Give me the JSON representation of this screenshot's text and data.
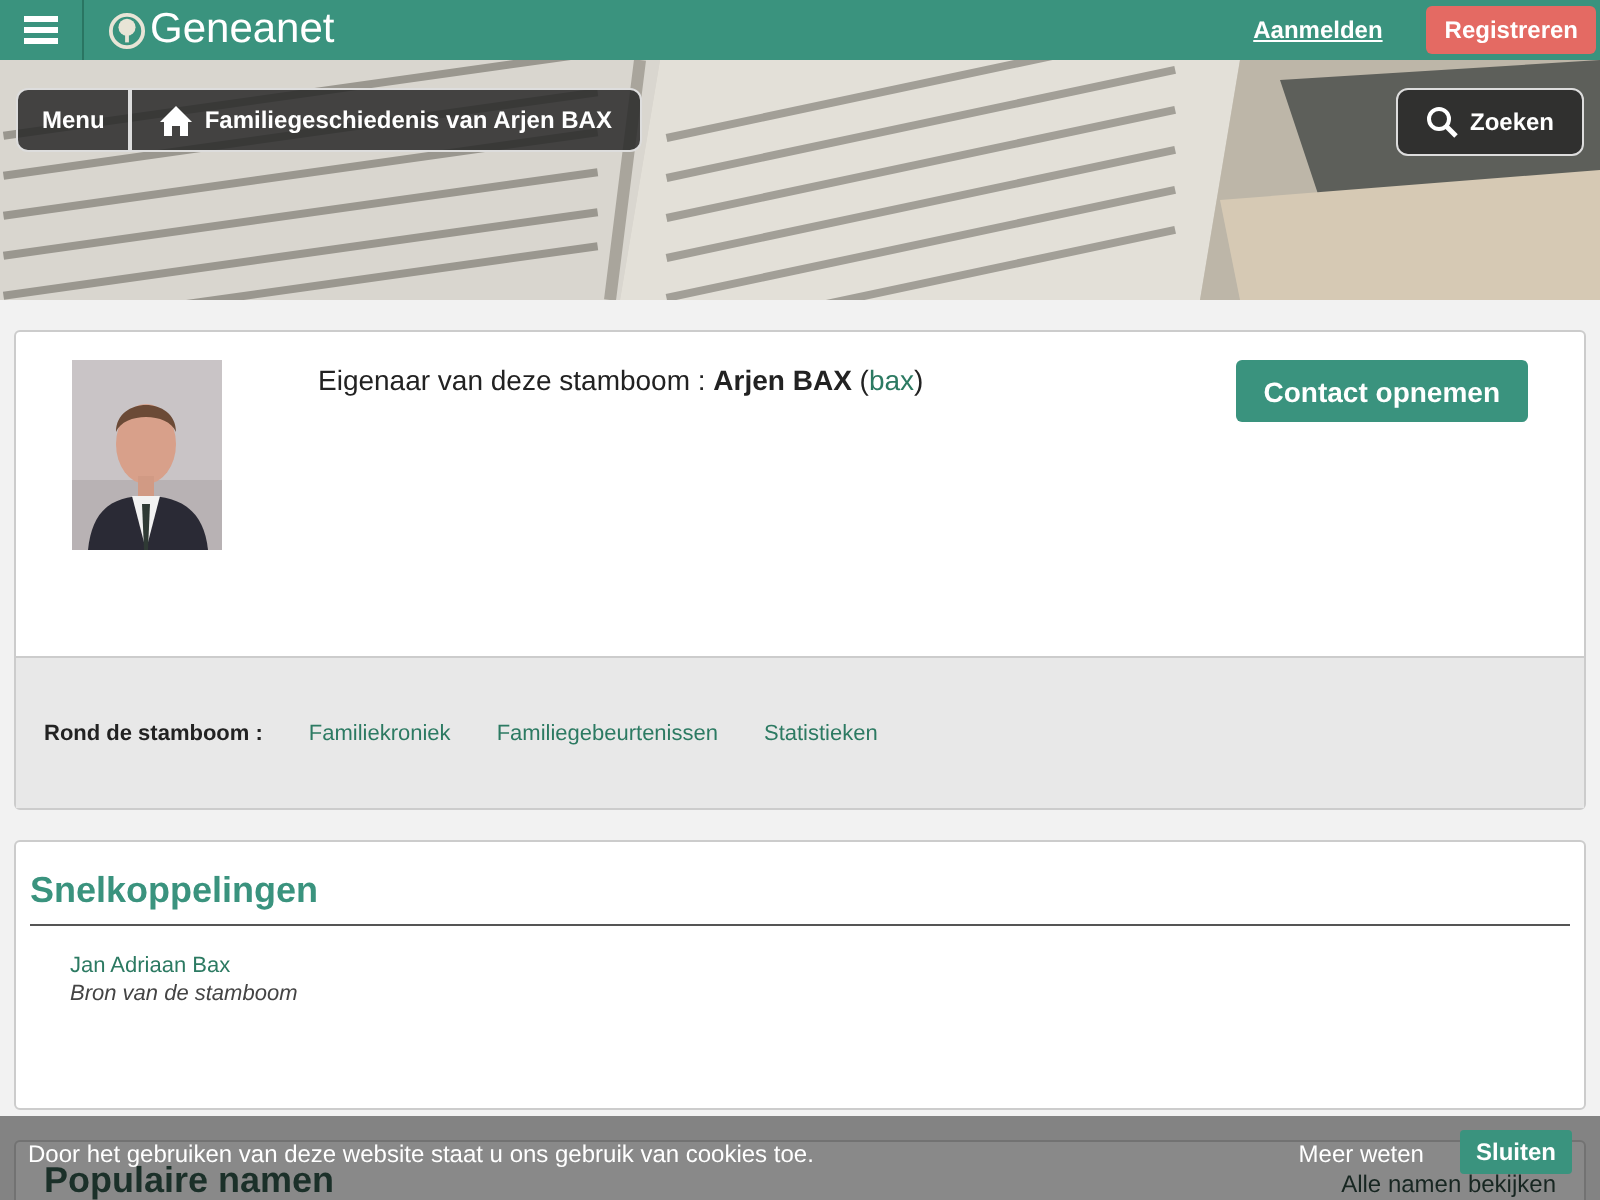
{
  "header": {
    "logo": "Geneanet",
    "login": "Aanmelden",
    "register": "Registreren"
  },
  "banner": {
    "kind": "picture",
    "menu": "Menu",
    "breadcrumb": "Familiegeschiedenis van Arjen BAX",
    "search": "Zoeken"
  },
  "owner": {
    "label": "Eigenaar van deze stamboom : ",
    "name": "Arjen BAX",
    "paren_open": "(",
    "username": "bax",
    "paren_close": ")",
    "contact": "Contact opnemen"
  },
  "around": {
    "label": "Rond de stamboom :",
    "links": [
      "Familiekroniek",
      "Familiegebeurtenissen",
      "Statistieken"
    ]
  },
  "shortcuts": {
    "title": "Snelkoppelingen",
    "items": [
      {
        "name": "Jan Adriaan Bax",
        "note": "Bron van de stamboom"
      }
    ]
  },
  "popular": {
    "title": "Populaire namen",
    "link": "Alle namen bekijken"
  },
  "cookie": {
    "text": "Door het gebruiken van deze website staat u ons gebruik van cookies toe.",
    "more": "Meer weten",
    "close": "Sluiten"
  }
}
